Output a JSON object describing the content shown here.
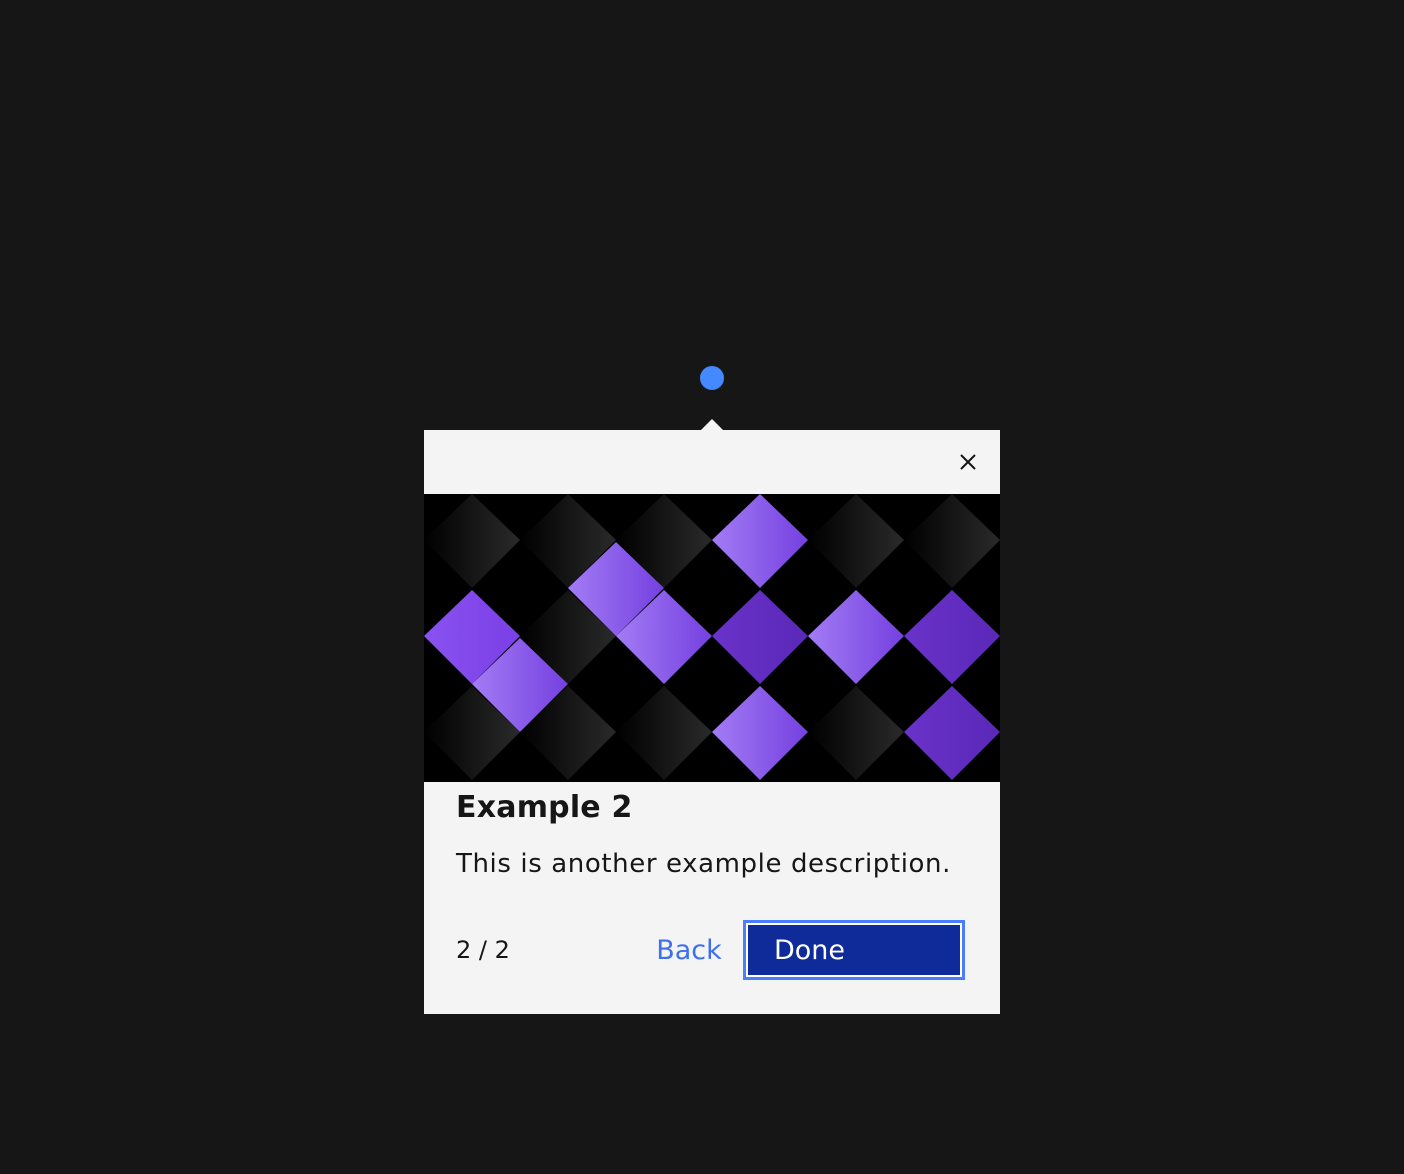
{
  "tooltip": {
    "title": "Example 2",
    "description": "This is another example description.",
    "step_counter": "2 / 2",
    "back_label": "Back",
    "done_label": "Done"
  },
  "colors": {
    "background": "#161616",
    "popover": "#f4f4f4",
    "hotspot": "#4589ff",
    "link": "#3d70ef",
    "primary_button": "#0f2a99",
    "focus_ring": "#4a7dff",
    "purple_light": "#9466f0",
    "purple_mid": "#7b46e8",
    "purple_dark": "#5f2cbf"
  },
  "icons": {
    "close": "close-icon",
    "hotspot": "hotspot-dot"
  }
}
